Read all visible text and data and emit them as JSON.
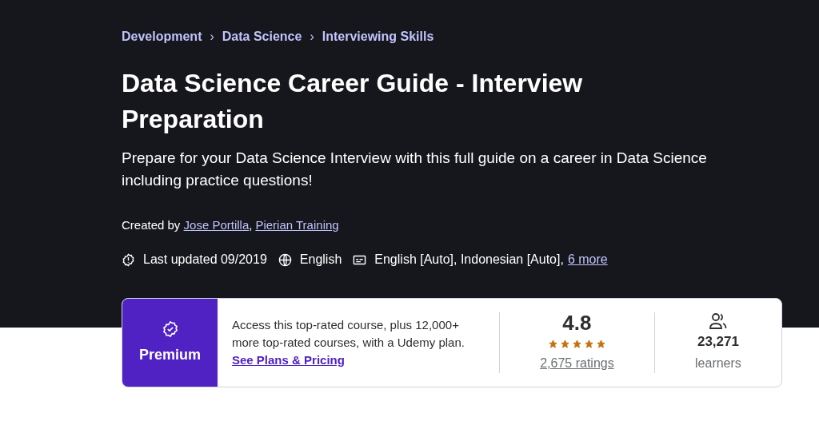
{
  "breadcrumb": [
    "Development",
    "Data Science",
    "Interviewing Skills"
  ],
  "separator": "›",
  "title": "Data Science Career Guide - Interview Preparation",
  "subtitle": "Prepare for your Data Science Interview with this full guide on a career in Data Science including practice questions!",
  "created_by": {
    "label": "Created by",
    "authors": [
      "Jose Portilla",
      "Pierian Training"
    ],
    "separator": ","
  },
  "meta": {
    "last_updated": "Last updated 09/2019",
    "language": "English",
    "captions": "English [Auto], Indonesian [Auto],",
    "more_link": "6 more"
  },
  "premium": {
    "label": "Premium",
    "text": "Access this top-rated course, plus 12,000+ more top-rated courses, with a Udemy plan.",
    "link": "See Plans & Pricing"
  },
  "rating": {
    "value": "4.8",
    "stars": 5,
    "count": "2,675 ratings"
  },
  "learners": {
    "count": "23,271",
    "label": "learners"
  }
}
